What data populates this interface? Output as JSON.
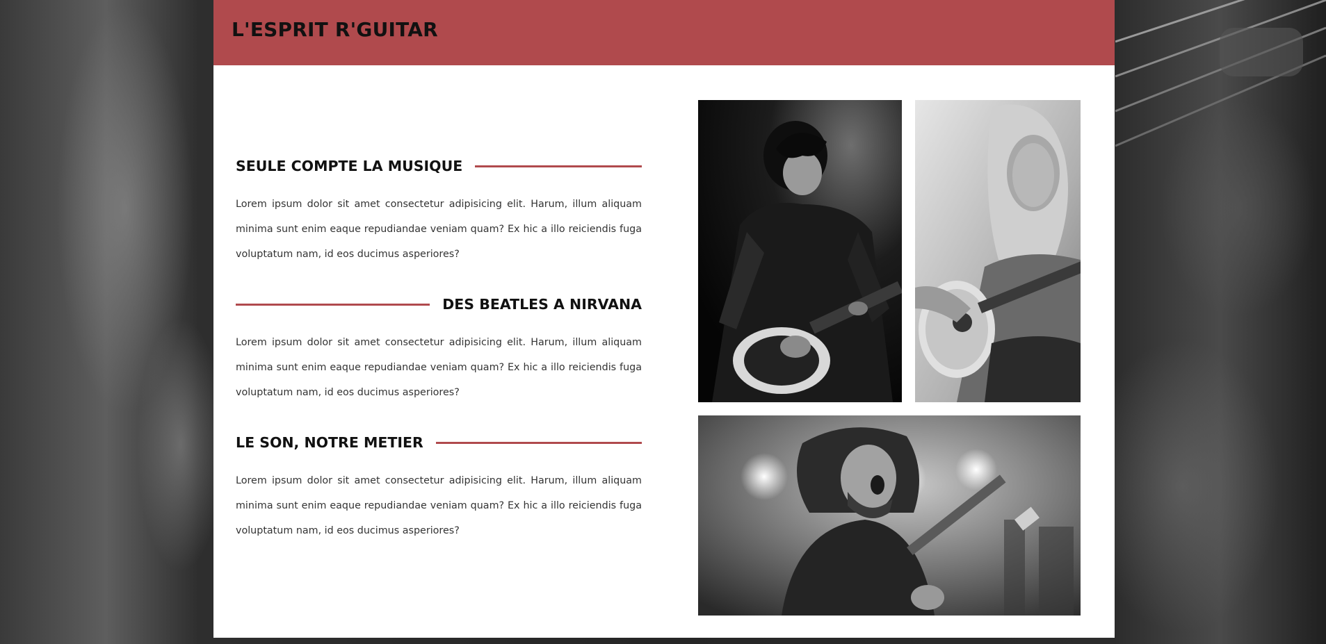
{
  "site": {
    "title": "L'ESPRIT R'GUITAR"
  },
  "sections": [
    {
      "title": "SEULE COMPTE LA MUSIQUE",
      "text": "Lorem ipsum dolor sit amet consectetur adipisicing elit. Harum, illum aliquam minima sunt enim eaque repudiandae veniam quam? Ex hic a illo reiciendis fuga voluptatum nam, id eos ducimus asperiores?"
    },
    {
      "title": "DES BEATLES A NIRVANA",
      "text": "Lorem ipsum dolor sit amet consectetur adipisicing elit. Harum, illum aliquam minima sunt enim eaque repudiandae veniam quam? Ex hic a illo reiciendis fuga voluptatum nam, id eos ducimus asperiores?"
    },
    {
      "title": "LE SON, NOTRE METIER",
      "text": "Lorem ipsum dolor sit amet consectetur adipisicing elit. Harum, illum aliquam minima sunt enim eaque repudiandae veniam quam? Ex hic a illo reiciendis fuga voluptatum nam, id eos ducimus asperiores?"
    }
  ],
  "colors": {
    "accent": "#b04a4d",
    "text": "#111111",
    "body_text": "#333333",
    "card": "#ffffff"
  }
}
